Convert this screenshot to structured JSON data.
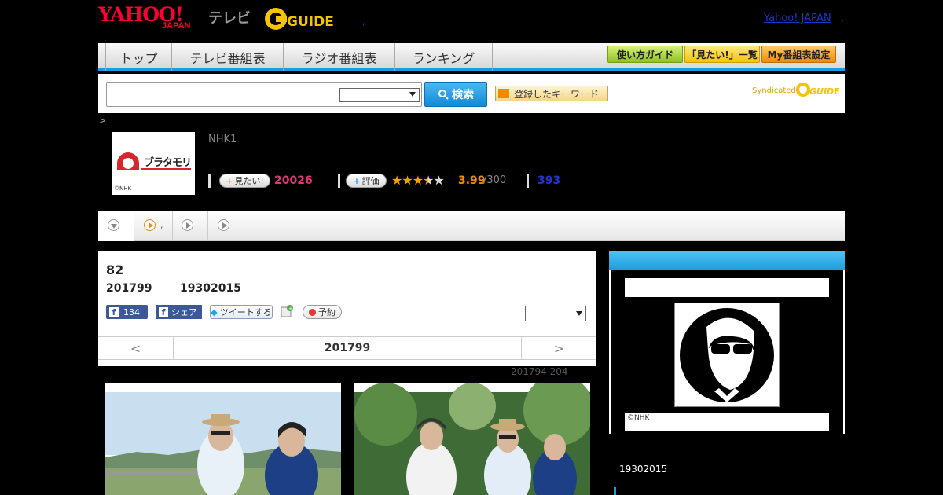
{
  "header": {
    "logo_yahoo": "YAHOO!",
    "logo_japan": "JAPAN",
    "logo_tv": "テレビ",
    "logo_gguide": "G-GUIDE",
    "yahoo_japan_link": "Yahoo! JAPAN",
    "dot": ",",
    "dot2": ","
  },
  "nav": {
    "tabs": [
      "トップ",
      "テレビ番組表",
      "ラジオ番組表",
      "ランキング"
    ],
    "guide_buttons": [
      "使い方ガイド",
      "「見たい!」一覧",
      "My番組表設定"
    ]
  },
  "search": {
    "button_label": "検索",
    "keyword_button": "登録したキーワード",
    "syndicated": "Syndicated"
  },
  "breadcrumb": ">",
  "program": {
    "thumbnail_copyright": "©NHK",
    "thumbnail_title": "ブラタモリ",
    "channel": "NHK1",
    "mitai_label": "見たい!",
    "mitai_count": "20026",
    "hyoka_label": "評価",
    "rating_value": 3.99,
    "rating": "3.99",
    "rating_total": "/300",
    "review_count": "393"
  },
  "tabs": {
    "sep": ","
  },
  "episode": {
    "title": "82",
    "date": "201799",
    "time": "19302015",
    "fb_like_count": "134",
    "fb_share_label": "シェア",
    "tweet_label": "ツイートする",
    "reserve_label": "予約",
    "pager_prev": "<",
    "pager_current": "201799",
    "pager_next": ">",
    "air_note": "201794  204"
  },
  "sidebar": {
    "copyright": "©NHK",
    "time": "19302015"
  },
  "colors": {
    "accent_blue": "#1a9de0",
    "yahoo_red": "#ff0033",
    "pink_count": "#e6337a",
    "rating_orange": "#f08a00",
    "gguide_yellow": "#f5c400"
  }
}
